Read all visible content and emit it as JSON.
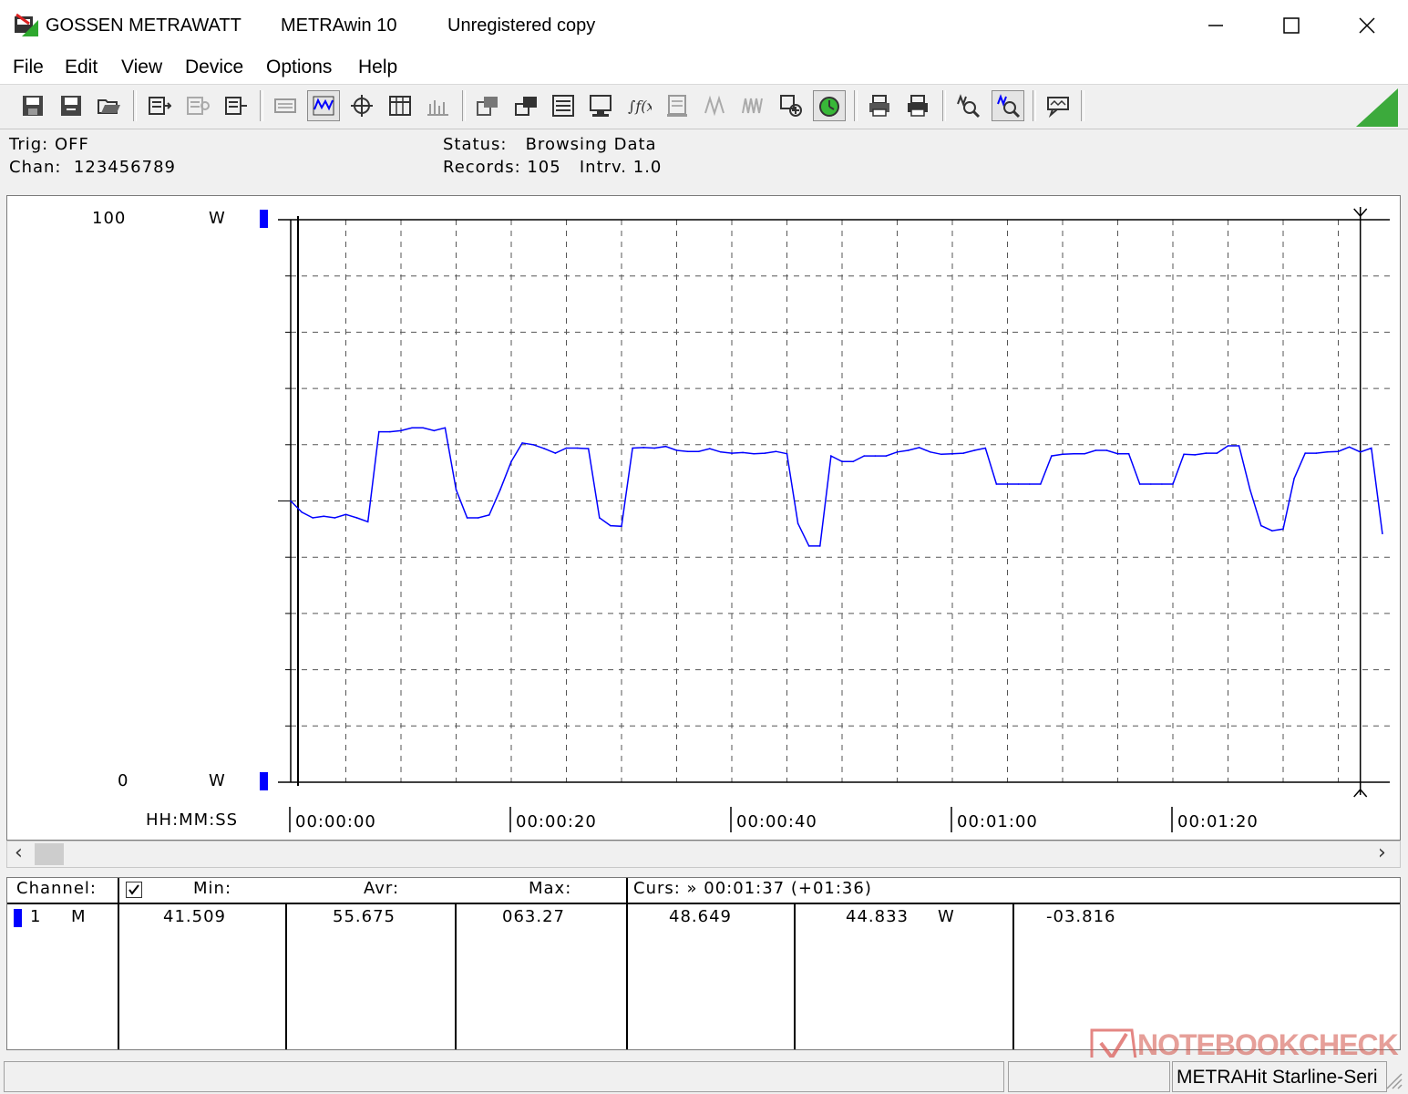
{
  "window": {
    "brand": "GOSSEN METRAWATT",
    "app": "METRAwin 10",
    "registration": "Unregistered copy"
  },
  "menu": [
    "File",
    "Edit",
    "View",
    "Device",
    "Options",
    "Help"
  ],
  "toolbar": {
    "icons": [
      "save-icon",
      "save-as-icon",
      "open-icon",
      "device-read-icon",
      "device-config-icon",
      "device-send-icon",
      "list-view-icon",
      "chart-view-icon",
      "crosshair-icon",
      "table-icon",
      "bar-view-icon",
      "window-tile-icon",
      "window-cascade-icon",
      "data-list-icon",
      "monitor-icon",
      "function-icon",
      "memory-icon",
      "signal-icon",
      "signal-multi-icon",
      "zoom-cursor-icon",
      "record-icon",
      "print-icon",
      "print-preview-icon",
      "zoom-icon",
      "zoom-signal-icon",
      "message-icon"
    ],
    "pressed": [
      "chart-view-icon",
      "record-icon",
      "zoom-signal-icon"
    ]
  },
  "info": {
    "trig": "Trig: OFF",
    "chan": "Chan:  123456789",
    "status": "Status:   Browsing Data",
    "records": "Records: 105   Intrv. 1.0"
  },
  "chart": {
    "y_top_value": "100",
    "y_top_unit": "W",
    "y_bottom_value": "0",
    "y_bottom_unit": "W",
    "time_format": "HH:MM:SS",
    "x_ticks": [
      "00:00:00",
      "00:00:20",
      "00:00:40",
      "00:01:00",
      "00:01:20"
    ]
  },
  "chart_data": {
    "type": "line",
    "ylim": [
      0,
      100
    ],
    "xlim": [
      0,
      99
    ],
    "grid": true,
    "y_unit": "W",
    "x_unit": "s",
    "series": [
      {
        "color": "#0000ff",
        "x": [
          0,
          1,
          2,
          3,
          4,
          5,
          6,
          7,
          8,
          9,
          10,
          11,
          12,
          13,
          14,
          15,
          16,
          17,
          18,
          19,
          20,
          21,
          22,
          23,
          24,
          25,
          26,
          27,
          28,
          29,
          30,
          31,
          32,
          33,
          34,
          35,
          36,
          37,
          38,
          39,
          40,
          41,
          42,
          43,
          44,
          45,
          46,
          47,
          48,
          49,
          50,
          51,
          52,
          53,
          54,
          55,
          56,
          57,
          58,
          59,
          60,
          61,
          62,
          63,
          64,
          65,
          66,
          67,
          68,
          69,
          70,
          71,
          72,
          73,
          74,
          75,
          76,
          77,
          78,
          79,
          80,
          81,
          82,
          83,
          84,
          85,
          86,
          87,
          88,
          89,
          90,
          91,
          92,
          93,
          94,
          95,
          96,
          97,
          98,
          99
        ],
        "values": [
          50,
          48,
          47,
          47.3,
          47,
          47.6,
          47,
          46.3,
          62.3,
          62.3,
          62.5,
          63,
          63,
          62.5,
          63,
          52,
          47,
          47,
          47.5,
          52,
          57,
          60.3,
          60,
          59.3,
          58.5,
          59.4,
          59.4,
          59.3,
          47,
          45.6,
          45.5,
          59.4,
          59.5,
          59.4,
          59.7,
          59,
          58.8,
          58.8,
          59.3,
          58.7,
          58.5,
          58.6,
          58.4,
          58.5,
          58.8,
          58.4,
          46,
          42,
          42,
          58,
          57,
          57,
          58,
          58,
          58,
          58.7,
          59,
          59.5,
          58.7,
          58.3,
          58.4,
          58.5,
          59,
          59.4,
          53,
          53,
          53,
          53,
          53,
          58,
          58.3,
          58.4,
          58.4,
          59,
          59,
          58.4,
          58.4,
          53,
          53,
          53,
          53,
          58.3,
          58.2,
          58.5,
          58.5,
          59.8,
          59.8,
          52,
          45.6,
          44.7,
          45,
          54,
          58.5,
          58.5,
          58.7,
          58.8,
          59.6,
          58.7,
          59.4,
          44.2
        ]
      }
    ]
  },
  "scrollbar": {
    "left_arrow": "‹",
    "right_arrow": "›"
  },
  "table": {
    "channel_header": "Channel:",
    "min_header": "Min:",
    "avr_header": "Avr:",
    "max_header": "Max:",
    "curs_header": "Curs: » 00:01:37 (+01:36)",
    "checkbox_checked": true,
    "row": {
      "channel": "1",
      "mode": "M",
      "min": "41.509",
      "avr": "55.675",
      "max": "063.27",
      "curs1": "48.649",
      "curs2": "44.833",
      "unit": "W",
      "diff": "-03.816"
    }
  },
  "statusbar": {
    "device": "METRAHit Starline-Seri"
  },
  "watermark": "NOTEBOOKCHECK"
}
